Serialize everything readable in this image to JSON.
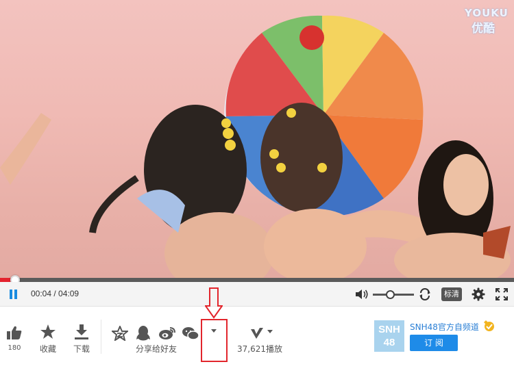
{
  "watermark": {
    "line1": "YOUKU",
    "line2": "优酷"
  },
  "player": {
    "time": "00:04 / 04:09",
    "progress_fraction": 0.029,
    "volume_fraction": 0.42,
    "quality_label": "标清"
  },
  "actions": {
    "like_count": "180",
    "favorite_label": "收藏",
    "download_label": "下载",
    "share_label": "分享给好友",
    "plays_label": "37,621播放"
  },
  "channel": {
    "logo_text": "SNH48",
    "name": "SNH48官方自频道",
    "subscribe_label": "订 阅"
  },
  "colors": {
    "accent": "#1e8be8",
    "progress": "#e4232e",
    "annotation": "#e2252c"
  },
  "icons": [
    "pause-icon",
    "volume-icon",
    "repeat-icon",
    "settings-icon",
    "fullscreen-icon",
    "thumbs-up-icon",
    "star-icon",
    "download-icon",
    "qzone-star-icon",
    "qq-penguin-icon",
    "weibo-icon",
    "wechat-icon",
    "dropdown-caret-icon",
    "v-logo-icon",
    "verified-badge-icon"
  ]
}
